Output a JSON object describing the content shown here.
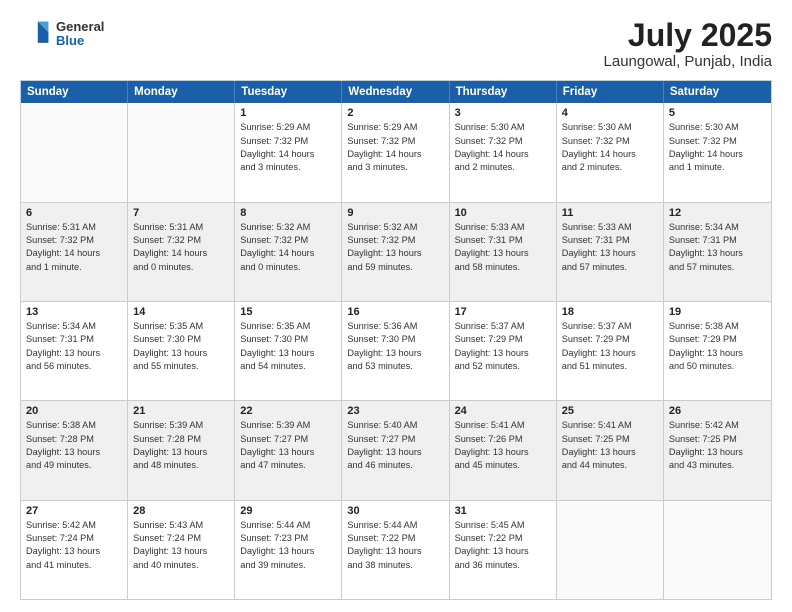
{
  "header": {
    "logo": {
      "general": "General",
      "blue": "Blue"
    },
    "month": "July 2025",
    "location": "Laungowal, Punjab, India"
  },
  "weekdays": [
    "Sunday",
    "Monday",
    "Tuesday",
    "Wednesday",
    "Thursday",
    "Friday",
    "Saturday"
  ],
  "rows": [
    [
      {
        "day": "",
        "text": "",
        "empty": true
      },
      {
        "day": "",
        "text": "",
        "empty": true
      },
      {
        "day": "1",
        "text": "Sunrise: 5:29 AM\nSunset: 7:32 PM\nDaylight: 14 hours\nand 3 minutes."
      },
      {
        "day": "2",
        "text": "Sunrise: 5:29 AM\nSunset: 7:32 PM\nDaylight: 14 hours\nand 3 minutes."
      },
      {
        "day": "3",
        "text": "Sunrise: 5:30 AM\nSunset: 7:32 PM\nDaylight: 14 hours\nand 2 minutes."
      },
      {
        "day": "4",
        "text": "Sunrise: 5:30 AM\nSunset: 7:32 PM\nDaylight: 14 hours\nand 2 minutes."
      },
      {
        "day": "5",
        "text": "Sunrise: 5:30 AM\nSunset: 7:32 PM\nDaylight: 14 hours\nand 1 minute."
      }
    ],
    [
      {
        "day": "6",
        "text": "Sunrise: 5:31 AM\nSunset: 7:32 PM\nDaylight: 14 hours\nand 1 minute."
      },
      {
        "day": "7",
        "text": "Sunrise: 5:31 AM\nSunset: 7:32 PM\nDaylight: 14 hours\nand 0 minutes."
      },
      {
        "day": "8",
        "text": "Sunrise: 5:32 AM\nSunset: 7:32 PM\nDaylight: 14 hours\nand 0 minutes."
      },
      {
        "day": "9",
        "text": "Sunrise: 5:32 AM\nSunset: 7:32 PM\nDaylight: 13 hours\nand 59 minutes."
      },
      {
        "day": "10",
        "text": "Sunrise: 5:33 AM\nSunset: 7:31 PM\nDaylight: 13 hours\nand 58 minutes."
      },
      {
        "day": "11",
        "text": "Sunrise: 5:33 AM\nSunset: 7:31 PM\nDaylight: 13 hours\nand 57 minutes."
      },
      {
        "day": "12",
        "text": "Sunrise: 5:34 AM\nSunset: 7:31 PM\nDaylight: 13 hours\nand 57 minutes."
      }
    ],
    [
      {
        "day": "13",
        "text": "Sunrise: 5:34 AM\nSunset: 7:31 PM\nDaylight: 13 hours\nand 56 minutes."
      },
      {
        "day": "14",
        "text": "Sunrise: 5:35 AM\nSunset: 7:30 PM\nDaylight: 13 hours\nand 55 minutes."
      },
      {
        "day": "15",
        "text": "Sunrise: 5:35 AM\nSunset: 7:30 PM\nDaylight: 13 hours\nand 54 minutes."
      },
      {
        "day": "16",
        "text": "Sunrise: 5:36 AM\nSunset: 7:30 PM\nDaylight: 13 hours\nand 53 minutes."
      },
      {
        "day": "17",
        "text": "Sunrise: 5:37 AM\nSunset: 7:29 PM\nDaylight: 13 hours\nand 52 minutes."
      },
      {
        "day": "18",
        "text": "Sunrise: 5:37 AM\nSunset: 7:29 PM\nDaylight: 13 hours\nand 51 minutes."
      },
      {
        "day": "19",
        "text": "Sunrise: 5:38 AM\nSunset: 7:29 PM\nDaylight: 13 hours\nand 50 minutes."
      }
    ],
    [
      {
        "day": "20",
        "text": "Sunrise: 5:38 AM\nSunset: 7:28 PM\nDaylight: 13 hours\nand 49 minutes."
      },
      {
        "day": "21",
        "text": "Sunrise: 5:39 AM\nSunset: 7:28 PM\nDaylight: 13 hours\nand 48 minutes."
      },
      {
        "day": "22",
        "text": "Sunrise: 5:39 AM\nSunset: 7:27 PM\nDaylight: 13 hours\nand 47 minutes."
      },
      {
        "day": "23",
        "text": "Sunrise: 5:40 AM\nSunset: 7:27 PM\nDaylight: 13 hours\nand 46 minutes."
      },
      {
        "day": "24",
        "text": "Sunrise: 5:41 AM\nSunset: 7:26 PM\nDaylight: 13 hours\nand 45 minutes."
      },
      {
        "day": "25",
        "text": "Sunrise: 5:41 AM\nSunset: 7:25 PM\nDaylight: 13 hours\nand 44 minutes."
      },
      {
        "day": "26",
        "text": "Sunrise: 5:42 AM\nSunset: 7:25 PM\nDaylight: 13 hours\nand 43 minutes."
      }
    ],
    [
      {
        "day": "27",
        "text": "Sunrise: 5:42 AM\nSunset: 7:24 PM\nDaylight: 13 hours\nand 41 minutes."
      },
      {
        "day": "28",
        "text": "Sunrise: 5:43 AM\nSunset: 7:24 PM\nDaylight: 13 hours\nand 40 minutes."
      },
      {
        "day": "29",
        "text": "Sunrise: 5:44 AM\nSunset: 7:23 PM\nDaylight: 13 hours\nand 39 minutes."
      },
      {
        "day": "30",
        "text": "Sunrise: 5:44 AM\nSunset: 7:22 PM\nDaylight: 13 hours\nand 38 minutes."
      },
      {
        "day": "31",
        "text": "Sunrise: 5:45 AM\nSunset: 7:22 PM\nDaylight: 13 hours\nand 36 minutes."
      },
      {
        "day": "",
        "text": "",
        "empty": true
      },
      {
        "day": "",
        "text": "",
        "empty": true
      }
    ]
  ]
}
